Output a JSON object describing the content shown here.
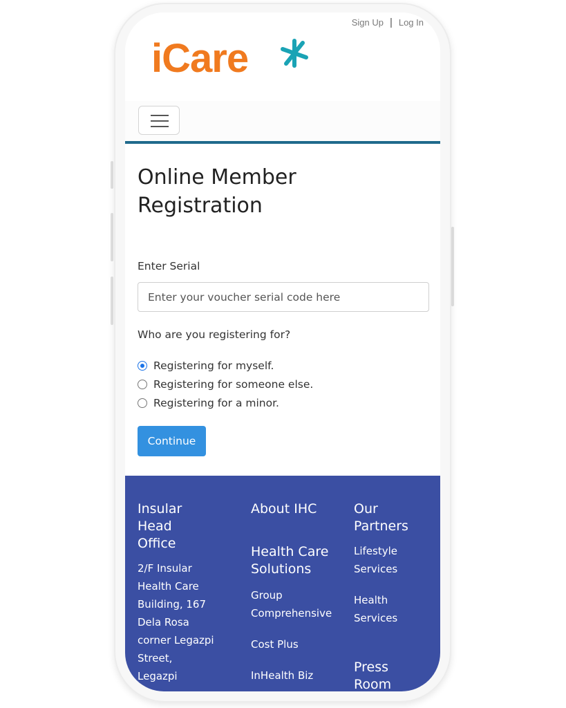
{
  "header": {
    "sign_up": "Sign Up",
    "separator": "|",
    "log_in": "Log In",
    "logo_text": "iCare"
  },
  "icons": {
    "menu": "hamburger-icon",
    "logo_mark": "asterisk-logo-icon"
  },
  "colors": {
    "brand_orange": "#f07a1f",
    "brand_teal": "#1aa3b5",
    "footer_blue": "#3b4fa3",
    "button_blue": "#3391e0"
  },
  "form": {
    "title_line1": "Online Member",
    "title_line2": "Registration",
    "serial_label": "Enter Serial",
    "serial_placeholder": "Enter your voucher serial code here",
    "serial_value": "",
    "question": "Who are you registering for?",
    "options": [
      {
        "label": "Registering for myself.",
        "checked": true
      },
      {
        "label": "Registering for someone else.",
        "checked": false
      },
      {
        "label": "Registering for a minor.",
        "checked": false
      }
    ],
    "continue_label": "Continue"
  },
  "footer": {
    "col1": {
      "h1": "Insular",
      "h2": "Head",
      "h3": "Office",
      "lines": [
        "2/F Insular",
        "Health Care",
        "Building, 167",
        "Dela Rosa",
        "corner Legazpi",
        "Street,",
        "Legazpi"
      ]
    },
    "col2": {
      "about": "About IHC",
      "hc1": "Health Care",
      "hc2": "Solutions",
      "g1": "Group",
      "g2": "Comprehensive",
      "cost_plus": "Cost Plus",
      "inhealth_biz": "InHealth Biz"
    },
    "col3": {
      "p1": "Our",
      "p2": "Partners",
      "l1": "Lifestyle",
      "l2": "Services",
      "hs1": "Health",
      "hs2": "Services",
      "pr1": "Press",
      "pr2": "Room"
    }
  }
}
